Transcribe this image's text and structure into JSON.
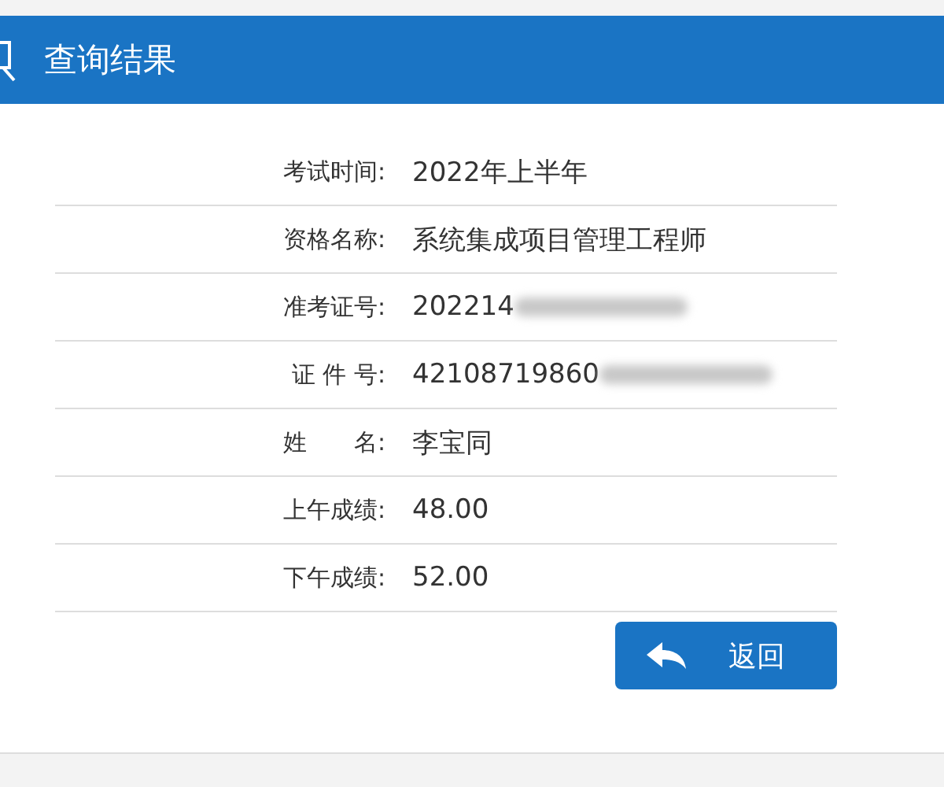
{
  "header": {
    "title": "查询结果"
  },
  "rows": [
    {
      "label": "考试时间:",
      "value": "2022年上半年",
      "redacted": false
    },
    {
      "label": "资格名称:",
      "value": "系统集成项目管理工程师",
      "redacted": false
    },
    {
      "label": "准考证号:",
      "value": "202214",
      "redacted": true
    },
    {
      "label": "证 件 号:",
      "value": "42108719860",
      "redacted": true
    },
    {
      "label": "姓　　名:",
      "value": "李宝同",
      "redacted": false
    },
    {
      "label": "上午成绩:",
      "value": "48.00",
      "redacted": false
    },
    {
      "label": "下午成绩:",
      "value": "52.00",
      "redacted": false
    }
  ],
  "button": {
    "label": "返回"
  }
}
